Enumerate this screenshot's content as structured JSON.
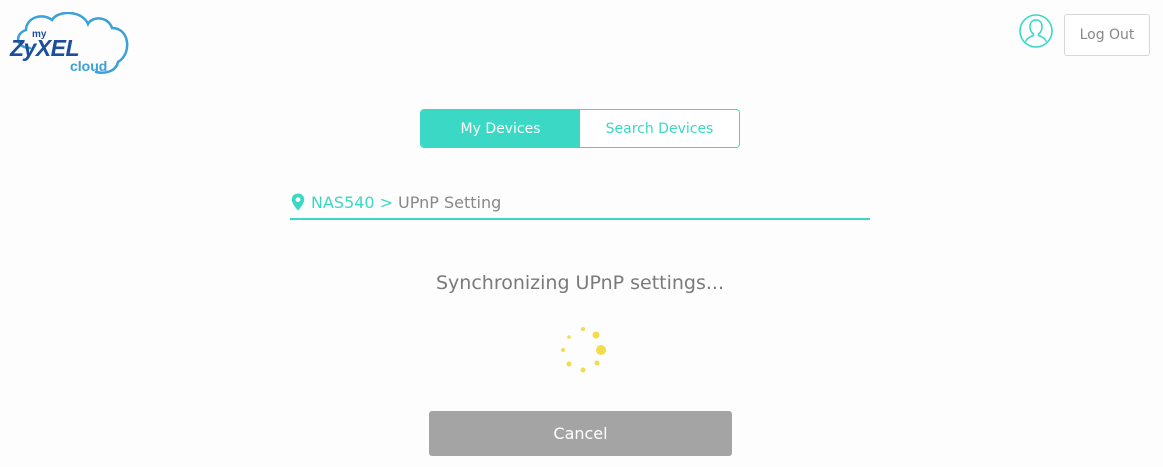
{
  "logo": {
    "my": "my",
    "brand": "ZyXEL",
    "cloud": "cloud",
    "icon": "zyxel-cloud-logo"
  },
  "header": {
    "avatar_icon": "user-avatar-icon",
    "logout_label": "Log Out"
  },
  "tabs": [
    {
      "label": "My Devices",
      "active": true
    },
    {
      "label": "Search Devices",
      "active": false
    }
  ],
  "breadcrumb": {
    "icon": "map-pin-icon",
    "device": "NAS540",
    "separator": ">",
    "current": "UPnP Setting"
  },
  "status": {
    "message": "Synchronizing UPnP settings...",
    "spinner_icon": "loading-spinner-icon"
  },
  "actions": {
    "cancel_label": "Cancel"
  },
  "colors": {
    "accent": "#3ad8c5",
    "brand_blue": "#1b4f9b",
    "cloud_blue": "#3aa0d8",
    "spinner": "#f2dc4a",
    "button_gray": "#a4a4a4",
    "text_gray": "#888888"
  }
}
